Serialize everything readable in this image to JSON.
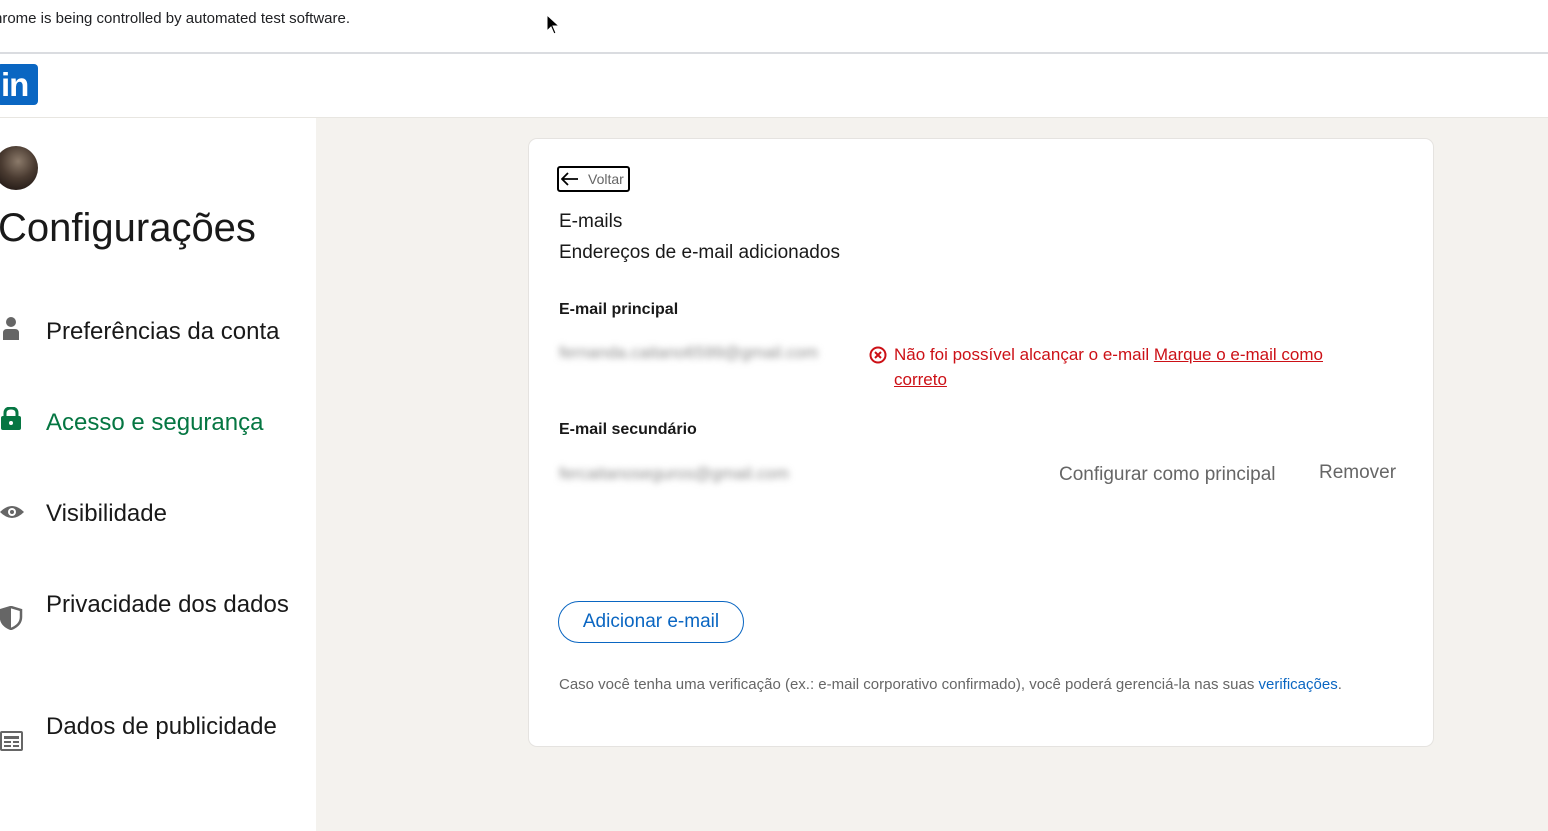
{
  "automation_banner": {
    "message": "hrome is being controlled by automated test software."
  },
  "header": {
    "logo_text": "in",
    "brand_color": "#0a66c2"
  },
  "sidebar": {
    "title": "Configurações",
    "items": [
      {
        "label": "Preferências da conta",
        "icon": "person-icon",
        "active": false
      },
      {
        "label": "Acesso e segurança",
        "icon": "lock-icon",
        "active": true
      },
      {
        "label": "Visibilidade",
        "icon": "eye-icon",
        "active": false
      },
      {
        "label": "Privacidade dos dados",
        "icon": "shield-icon",
        "active": false
      },
      {
        "label": "Dados de publicidade",
        "icon": "ad-icon",
        "active": false
      }
    ],
    "active_color": "#057642"
  },
  "card": {
    "back_label": "Voltar",
    "title": "E-mails",
    "subtitle": "Endereços de e-mail adicionados",
    "primary": {
      "label": "E-mail principal",
      "email": "fernanda.caitano6599@gmail.com",
      "error_text": "Não foi possível alcançar o e-mail",
      "error_link": "Marque o e-mail como correto",
      "error_color": "#cc1016"
    },
    "secondary": {
      "label": "E-mail secundário",
      "email": "fercaitanoseguros@gmail.com",
      "set_primary_label": "Configurar como principal",
      "remove_label": "Remover"
    },
    "add_email_label": "Adicionar e-mail",
    "footnote_text": "Caso você tenha uma verificação (ex.: e-mail corporativo confirmado), você poderá gerenciá-la nas suas ",
    "footnote_link": "verificações",
    "footnote_end": "."
  }
}
